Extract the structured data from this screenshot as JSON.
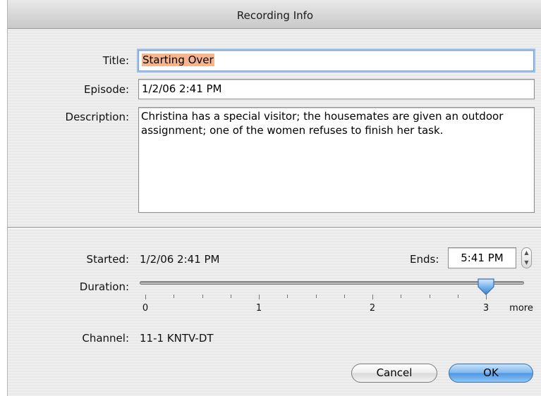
{
  "window": {
    "title": "Recording Info"
  },
  "form": {
    "title_label": "Title:",
    "title_value": "Starting Over",
    "episode_label": "Episode:",
    "episode_value": "1/2/06 2:41 PM",
    "description_label": "Description:",
    "description_value": "Christina has a special visitor; the housemates are given an outdoor assignment; one of the women refuses to finish her task."
  },
  "schedule": {
    "started_label": "Started:",
    "started_value": "1/2/06 2:41 PM",
    "ends_label": "Ends:",
    "ends_value": "5:41 PM",
    "duration_label": "Duration:",
    "duration_value_hours": 3,
    "duration_ticks": [
      "0",
      "1",
      "2",
      "3",
      "more"
    ],
    "channel_label": "Channel:",
    "channel_value": "11-1 KNTV-DT"
  },
  "buttons": {
    "cancel_label": "Cancel",
    "ok_label": "OK"
  },
  "icons": {
    "stepper_up": "stepper-up-icon",
    "stepper_down": "stepper-down-icon",
    "slider_thumb": "slider-thumb-icon"
  },
  "colors": {
    "accent": "#4f97e3",
    "selection": "#f7b58d",
    "focus_ring": "#9cc1ec"
  }
}
